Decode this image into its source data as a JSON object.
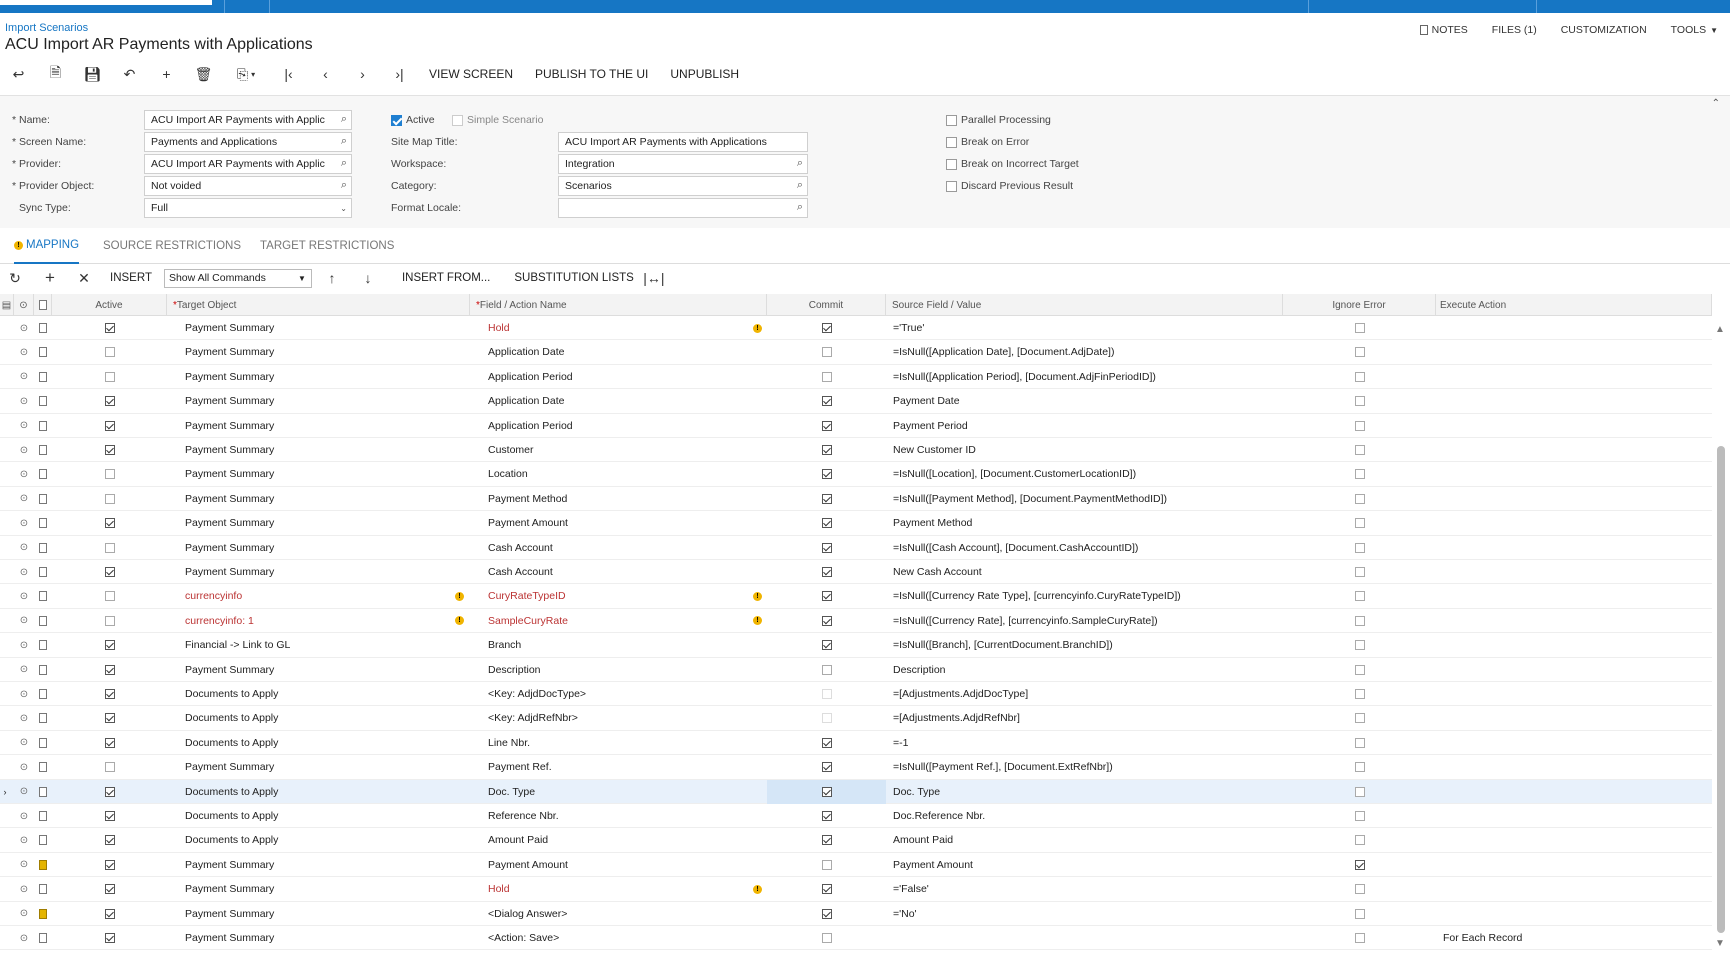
{
  "header": {
    "breadcrumb": "Import Scenarios",
    "title": "ACU Import AR Payments with Applications",
    "links": {
      "notes": "NOTES",
      "files": "FILES (1)",
      "customization": "CUSTOMIZATION",
      "tools": "TOOLS"
    }
  },
  "toolbar": {
    "view_screen": "VIEW SCREEN",
    "publish": "PUBLISH TO THE UI",
    "unpublish": "UNPUBLISH"
  },
  "form": {
    "name_label": "* Name:",
    "name_value": "ACU Import AR Payments with Applic",
    "screen_label": "* Screen Name:",
    "screen_value": "Payments and Applications",
    "provider_label": "* Provider:",
    "provider_value": "ACU Import AR Payments with Applic",
    "provider_object_label": "* Provider Object:",
    "provider_object_value": "Not voided",
    "sync_label": "Sync Type:",
    "sync_value": "Full",
    "active_label": "Active",
    "simple_label": "Simple Scenario",
    "sitemap_label": "Site Map Title:",
    "sitemap_value": "ACU Import AR Payments with Applications",
    "workspace_label": "Workspace:",
    "workspace_value": "Integration",
    "category_label": "Category:",
    "category_value": "Scenarios",
    "locale_label": "Format Locale:",
    "locale_value": "",
    "parallel_label": "Parallel Processing",
    "break_error_label": "Break on Error",
    "break_target_label": "Break on Incorrect Target",
    "discard_label": "Discard Previous Result"
  },
  "tabs": {
    "mapping": "MAPPING",
    "source": "SOURCE RESTRICTIONS",
    "target": "TARGET RESTRICTIONS"
  },
  "gridbar": {
    "insert": "INSERT",
    "commands_select": "Show All Commands",
    "insert_from": "INSERT FROM...",
    "substitution": "SUBSTITUTION LISTS"
  },
  "columns": {
    "active": "Active",
    "target": "Target Object",
    "field": "Field / Action Name",
    "commit": "Commit",
    "source": "Source Field / Value",
    "ignore": "Ignore Error",
    "execute": "Execute Action"
  },
  "rows": [
    {
      "active": true,
      "target": "Payment Summary",
      "field": "Hold",
      "field_warn": true,
      "commit": true,
      "source": "='True'",
      "ignore": false,
      "execute": ""
    },
    {
      "active": false,
      "target": "Payment Summary",
      "field": "Application Date",
      "commit": false,
      "source": "=IsNull([Application Date], [Document.AdjDate])",
      "ignore": false,
      "execute": ""
    },
    {
      "active": false,
      "target": "Payment Summary",
      "field": "Application Period",
      "commit": false,
      "source": "=IsNull([Application Period], [Document.AdjFinPeriodID])",
      "ignore": false,
      "execute": ""
    },
    {
      "active": true,
      "target": "Payment Summary",
      "field": "Application Date",
      "commit": true,
      "source": "Payment Date",
      "ignore": false,
      "execute": ""
    },
    {
      "active": true,
      "target": "Payment Summary",
      "field": "Application Period",
      "commit": true,
      "source": "Payment Period",
      "ignore": false,
      "execute": ""
    },
    {
      "active": true,
      "target": "Payment Summary",
      "field": "Customer",
      "commit": true,
      "source": "New Customer ID",
      "ignore": false,
      "execute": ""
    },
    {
      "active": false,
      "target": "Payment Summary",
      "field": "Location",
      "commit": true,
      "source": "=IsNull([Location], [Document.CustomerLocationID])",
      "ignore": false,
      "execute": ""
    },
    {
      "active": false,
      "target": "Payment Summary",
      "field": "Payment Method",
      "commit": true,
      "source": "=IsNull([Payment Method], [Document.PaymentMethodID])",
      "ignore": false,
      "execute": ""
    },
    {
      "active": true,
      "target": "Payment Summary",
      "field": "Payment Amount",
      "commit": true,
      "source": "Payment Method",
      "ignore": false,
      "execute": ""
    },
    {
      "active": false,
      "target": "Payment Summary",
      "field": "Cash Account",
      "commit": true,
      "source": "=IsNull([Cash Account], [Document.CashAccountID])",
      "ignore": false,
      "execute": ""
    },
    {
      "active": true,
      "target": "Payment Summary",
      "field": "Cash Account",
      "commit": true,
      "source": "New Cash Account",
      "ignore": false,
      "execute": ""
    },
    {
      "active": false,
      "target": "currencyinfo",
      "target_warn": true,
      "field": "CuryRateTypeID",
      "field_warn": true,
      "commit": true,
      "source": "=IsNull([Currency Rate Type], [currencyinfo.CuryRateTypeID])",
      "ignore": false,
      "execute": ""
    },
    {
      "active": false,
      "target": "currencyinfo: 1",
      "target_warn": true,
      "field": "SampleCuryRate",
      "field_warn": true,
      "commit": true,
      "source": "=IsNull([Currency Rate], [currencyinfo.SampleCuryRate])",
      "ignore": false,
      "execute": ""
    },
    {
      "active": true,
      "target": "Financial -> Link to GL",
      "field": "Branch",
      "commit": true,
      "source": "=IsNull([Branch], [CurrentDocument.BranchID])",
      "ignore": false,
      "execute": ""
    },
    {
      "active": true,
      "target": "Payment Summary",
      "field": "Description",
      "commit": false,
      "source": "Description",
      "ignore": false,
      "execute": ""
    },
    {
      "active": true,
      "target": "Documents to Apply",
      "field": "<Key: AdjdDocType>",
      "commit": false,
      "commit_faded": true,
      "source": "=[Adjustments.AdjdDocType]",
      "ignore": false,
      "execute": ""
    },
    {
      "active": true,
      "target": "Documents to Apply",
      "field": "<Key: AdjdRefNbr>",
      "commit": false,
      "commit_faded": true,
      "source": "=[Adjustments.AdjdRefNbr]",
      "ignore": false,
      "execute": ""
    },
    {
      "active": true,
      "target": "Documents to Apply",
      "field": "Line Nbr.",
      "commit": true,
      "source": "=-1",
      "ignore": false,
      "execute": ""
    },
    {
      "active": false,
      "target": "Payment Summary",
      "field": "Payment Ref.",
      "commit": true,
      "source": "=IsNull([Payment Ref.], [Document.ExtRefNbr])",
      "ignore": false,
      "execute": ""
    },
    {
      "active": true,
      "target": "Documents to Apply",
      "field": "Doc. Type",
      "commit": true,
      "source": "Doc. Type",
      "ignore": false,
      "execute": "",
      "selected": true
    },
    {
      "active": true,
      "target": "Documents to Apply",
      "field": "Reference Nbr.",
      "commit": true,
      "source": "Doc.Reference Nbr.",
      "ignore": false,
      "execute": ""
    },
    {
      "active": true,
      "target": "Documents to Apply",
      "field": "Amount Paid",
      "commit": true,
      "source": "Amount Paid",
      "ignore": false,
      "execute": ""
    },
    {
      "active": true,
      "target": "Payment Summary",
      "field": "Payment Amount",
      "commit": false,
      "source": "Payment Amount",
      "ignore": true,
      "execute": "",
      "yellow_doc": true
    },
    {
      "active": true,
      "target": "Payment Summary",
      "field": "Hold",
      "field_warn": true,
      "commit": true,
      "source": "='False'",
      "ignore": false,
      "execute": ""
    },
    {
      "active": true,
      "target": "Payment Summary",
      "field": "<Dialog Answer>",
      "commit": true,
      "source": "='No'",
      "ignore": false,
      "execute": "",
      "yellow_doc": true
    },
    {
      "active": true,
      "target": "Payment Summary",
      "field": "<Action: Save>",
      "commit": false,
      "source": "",
      "ignore": false,
      "execute": "For Each Record"
    }
  ]
}
